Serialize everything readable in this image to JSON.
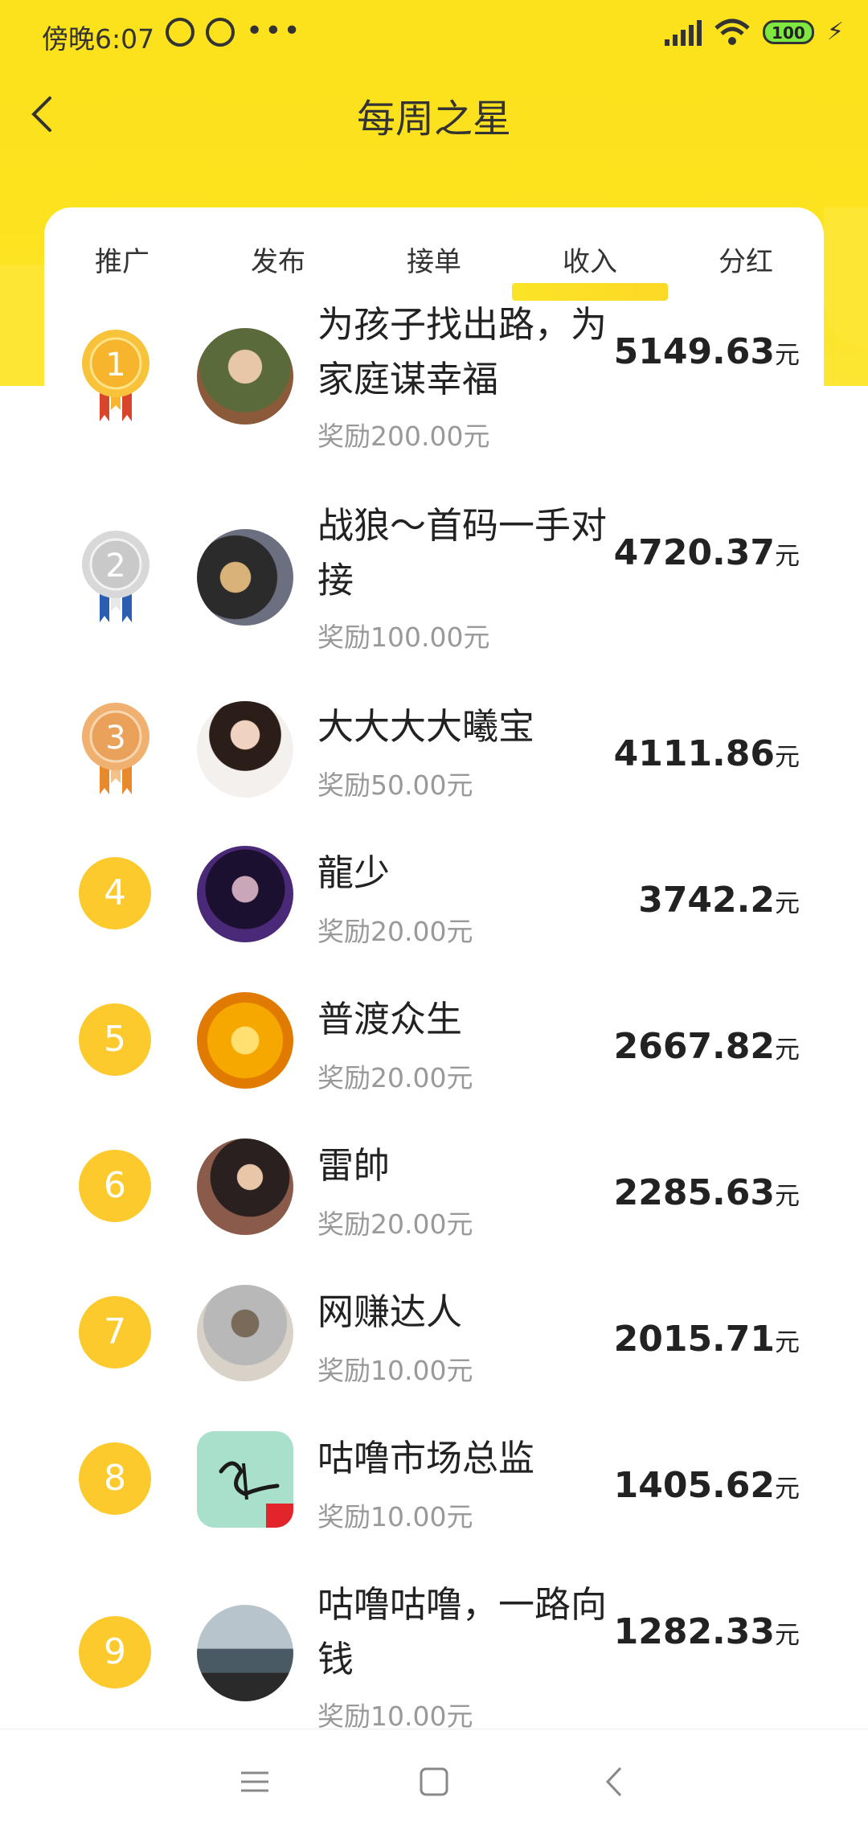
{
  "status": {
    "time": "傍晚6:07",
    "dots": "•••",
    "battery": "100"
  },
  "header": {
    "title": "每周之星"
  },
  "tabs": [
    {
      "label": "推广"
    },
    {
      "label": "发布"
    },
    {
      "label": "接单"
    },
    {
      "label": "收入"
    },
    {
      "label": "分红"
    }
  ],
  "active_tab": "收入",
  "colors": {
    "brand_yellow": "#fde31f",
    "rank_circle": "#fcca2c",
    "gold": "#f6b52c",
    "silver": "#c9c9c9",
    "bronze": "#eaa25a"
  },
  "ranking": [
    {
      "rank": "1",
      "name": "为孩子找出路，为家庭谋幸福",
      "reward": "奖励200.00元",
      "amount": "5149.63",
      "unit": "元"
    },
    {
      "rank": "2",
      "name": "战狼～首码一手对接",
      "reward": "奖励100.00元",
      "amount": "4720.37",
      "unit": "元"
    },
    {
      "rank": "3",
      "name": "大大大大曦宝",
      "reward": "奖励50.00元",
      "amount": "4111.86",
      "unit": "元"
    },
    {
      "rank": "4",
      "name": "龍少",
      "reward": "奖励20.00元",
      "amount": "3742.2",
      "unit": "元"
    },
    {
      "rank": "5",
      "name": "普渡众生",
      "reward": "奖励20.00元",
      "amount": "2667.82",
      "unit": "元"
    },
    {
      "rank": "6",
      "name": "雷帥",
      "reward": "奖励20.00元",
      "amount": "2285.63",
      "unit": "元"
    },
    {
      "rank": "7",
      "name": "网赚达人",
      "reward": "奖励10.00元",
      "amount": "2015.71",
      "unit": "元"
    },
    {
      "rank": "8",
      "name": "咕噜市场总监",
      "reward": "奖励10.00元",
      "amount": "1405.62",
      "unit": "元"
    },
    {
      "rank": "9",
      "name": "咕噜咕噜，一路向钱",
      "reward": "奖励10.00元",
      "amount": "1282.33",
      "unit": "元"
    }
  ]
}
